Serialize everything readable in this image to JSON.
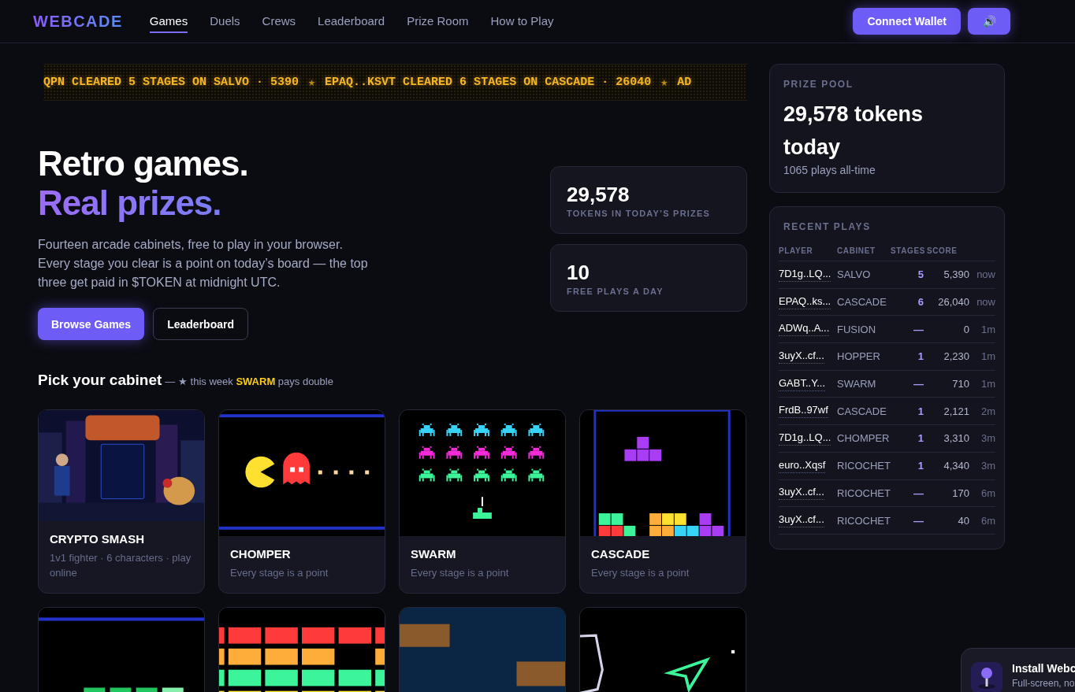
{
  "brand": "WEBCADE",
  "nav": [
    {
      "label": "Games",
      "selected": true
    },
    {
      "label": "Duels",
      "selected": false
    },
    {
      "label": "Crews",
      "selected": false
    },
    {
      "label": "Leaderboard",
      "selected": false
    },
    {
      "label": "Prize Room",
      "selected": false
    },
    {
      "label": "How to Play",
      "selected": false
    }
  ],
  "header_actions": {
    "connect": "Connect Wallet",
    "sound_icon": "🔊"
  },
  "ticker": [
    "QPN CLEARED 5 STAGES ON SALVO · 5390",
    "★",
    "EPAQ..KSVT CLEARED 6 STAGES ON CASCADE · 26040",
    "★",
    "AD"
  ],
  "hero": {
    "title_lines": [
      "Retro games.",
      "Real prizes."
    ],
    "body": "Fourteen arcade cabinets, free to play in your browser. Every stage you clear is a point on today’s board — the top three get paid in $TOKEN at midnight UTC.",
    "buttons": [
      {
        "label": "Browse Games",
        "kind": "primary"
      },
      {
        "label": "Leaderboard",
        "kind": "outline"
      }
    ]
  },
  "stats": [
    {
      "value": "29,578",
      "label": "TOKENS IN TODAY’S PRIZES"
    },
    {
      "value": "10",
      "label": "FREE PLAYS A DAY"
    }
  ],
  "cabinets_section": {
    "title": "Pick your cabinet",
    "note": "— ★ this week **SWARM** pays double"
  },
  "cabinets": [
    {
      "kind": "picture",
      "title": "CRYPTO SMASH",
      "subtitle": "1v1 fighter · 6 characters · play online"
    },
    {
      "kind": "chomper",
      "title": "CHOMPER",
      "subtitle": "Every stage is a point"
    },
    {
      "kind": "swarm",
      "title": "SWARM",
      "subtitle": "Every stage is a point"
    },
    {
      "kind": "cascade",
      "title": "CASCADE",
      "subtitle": "Every stage is a point"
    },
    {
      "kind": "snake"
    },
    {
      "kind": "bricks"
    },
    {
      "kind": "crossing"
    },
    {
      "kind": "asteroids"
    }
  ],
  "prize_pool": {
    "label": "PRIZE POOL",
    "amount": "29,578 tokens today",
    "note": "1065 plays all-time"
  },
  "recent_plays": {
    "label": "RECENT PLAYS",
    "columns": [
      "PLAYER",
      "CABINET",
      "STAGES",
      "SCORE"
    ],
    "rows": [
      {
        "player": "7D1g..LQ...",
        "cabinet": "SALVO",
        "stages": "5",
        "score": "5,390",
        "time": "now"
      },
      {
        "player": "EPAQ..ks...",
        "cabinet": "CASCADE",
        "stages": "6",
        "score": "26,040",
        "time": "now"
      },
      {
        "player": "ADWq..A...",
        "cabinet": "FUSION",
        "stages": "—",
        "score": "0",
        "time": "1m"
      },
      {
        "player": "3uyX..cf...",
        "cabinet": "HOPPER",
        "stages": "1",
        "score": "2,230",
        "time": "1m"
      },
      {
        "player": "GABT..Y...",
        "cabinet": "SWARM",
        "stages": "—",
        "score": "710",
        "time": "1m"
      },
      {
        "player": "FrdB..97wf",
        "cabinet": "CASCADE",
        "stages": "1",
        "score": "2,121",
        "time": "2m"
      },
      {
        "player": "7D1g..LQ...",
        "cabinet": "CHOMPER",
        "stages": "1",
        "score": "3,310",
        "time": "3m"
      },
      {
        "player": "euro..Xqsf",
        "cabinet": "RICOCHET",
        "stages": "1",
        "score": "4,340",
        "time": "3m"
      },
      {
        "player": "3uyX..cf...",
        "cabinet": "RICOCHET",
        "stages": "—",
        "score": "170",
        "time": "6m"
      },
      {
        "player": "3uyX..cf...",
        "cabinet": "RICOCHET",
        "stages": "—",
        "score": "40",
        "time": "6m"
      }
    ]
  },
  "install_toast": {
    "title": "Install Webc",
    "body": "Full-screen, no"
  }
}
